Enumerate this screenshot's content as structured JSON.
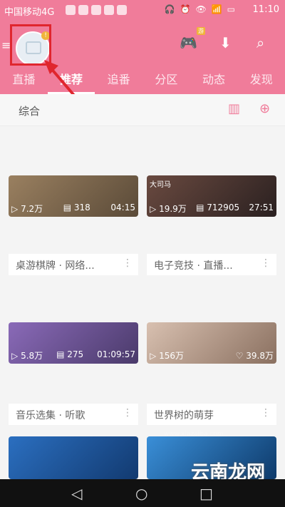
{
  "status_bar": {
    "carrier": "中国移动4G",
    "time": "11:10"
  },
  "tabs": [
    {
      "label": "直播",
      "active": false
    },
    {
      "label": "推荐",
      "active": true
    },
    {
      "label": "追番",
      "active": false
    },
    {
      "label": "分区",
      "active": false
    },
    {
      "label": "动态",
      "active": false
    },
    {
      "label": "发现",
      "active": false
    }
  ],
  "subbar": {
    "label": "综合"
  },
  "avatar": {
    "badge": "!"
  },
  "game_badge": "游",
  "cards": [
    {
      "views": "7.2万",
      "danmaku": "318",
      "duration": "04:15",
      "title": "桌游棋牌 · 网络...",
      "thumb_color": "#7a6a55"
    },
    {
      "views": "19.9万",
      "danmaku": "712905",
      "duration": "27:51",
      "title": "电子竞技 · 直播...",
      "thumb_color": "#4a3a38",
      "overlay": "大司马"
    },
    {
      "views": "5.8万",
      "danmaku": "275",
      "duration": "01:09:57",
      "title": "音乐选集 · 听歌",
      "thumb_color": "#6a5a9a"
    },
    {
      "views": "156万",
      "likes": "39.8万",
      "title": "世界树的萌芽",
      "thumb_color": "#b8a090"
    },
    {
      "title": "",
      "thumb_color": "#1f5fa8"
    },
    {
      "title": "",
      "thumb_color": "#2b7fc4"
    }
  ],
  "watermark": {
    "text": "云南龙网",
    "url": "www.xiazaiba.com"
  },
  "colors": {
    "brand": "#f07c9a",
    "highlight": "#e0262e"
  }
}
